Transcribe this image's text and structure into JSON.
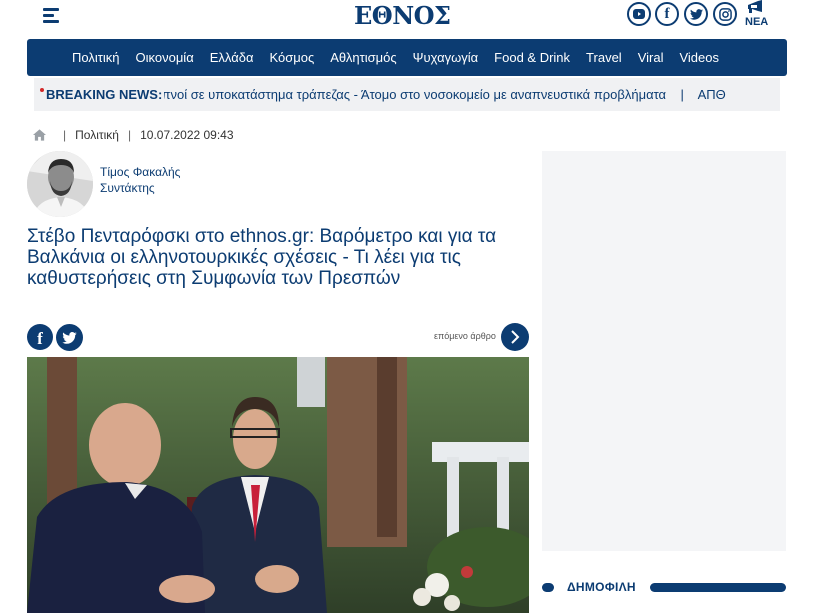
{
  "header": {
    "logo": "ΕΘΝΟΣ",
    "social": [
      {
        "name": "youtube-icon",
        "glyph": "▶"
      },
      {
        "name": "facebook-icon",
        "glyph": "f"
      },
      {
        "name": "twitter-icon",
        "glyph": "t"
      },
      {
        "name": "instagram-icon",
        "glyph": "◎"
      }
    ],
    "nea_label": "ΝΕΑ"
  },
  "nav": {
    "items": [
      "Πολιτική",
      "Οικονομία",
      "Ελλάδα",
      "Κόσμος",
      "Αθλητισμός",
      "Ψυχαγωγία",
      "Food & Drink",
      "Travel",
      "Viral",
      "Videos"
    ]
  },
  "breaking": {
    "label": "BREAKING NEWS:",
    "ticker": "απνοί σε υποκατάστημα τράπεζας - Άτομο στο νοσοκομείο με αναπνευστικά προβλήματα    |    ΑΠΘ"
  },
  "breadcrumb": {
    "section": "Πολιτική",
    "date": "10.07.2022 09:43"
  },
  "author": {
    "name": "Τίμος Φακαλής",
    "role": "Συντάκτης"
  },
  "article": {
    "title": "Στέβο Πενταρόφσκι στο ethnos.gr: Βαρόμετρο και για τα Βαλκάνια οι ελληνοτουρκικές σχέσεις - Τι λέει για τις καθυστερήσεις στη Συμφωνία των Πρεσπών",
    "next_label": "επόμενο άρθρο"
  },
  "sidebar": {
    "popular_label": "ΔΗΜΟΦΙΛΗ"
  },
  "colors": {
    "brand": "#0c3c72",
    "breaking_dot": "#d32a2a"
  }
}
